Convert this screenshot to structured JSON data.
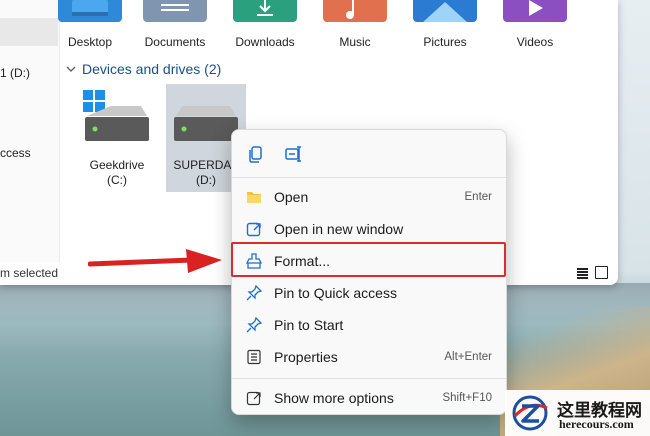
{
  "explorer": {
    "sidebar": {
      "items": [
        {
          "label": "1 (D:)"
        },
        {
          "label": "ccess"
        }
      ]
    },
    "status": {
      "text": "m selected"
    },
    "folders": [
      {
        "label": "Desktop",
        "icon": "desktop-folder-icon",
        "color": "#2e8ad8"
      },
      {
        "label": "Documents",
        "icon": "documents-folder-icon",
        "color": "#8096b0"
      },
      {
        "label": "Downloads",
        "icon": "downloads-folder-icon",
        "color": "#2aa07f"
      },
      {
        "label": "Music",
        "icon": "music-folder-icon",
        "color": "#e0704e"
      },
      {
        "label": "Pictures",
        "icon": "pictures-folder-icon",
        "color": "#2a7bd1"
      },
      {
        "label": "Videos",
        "icon": "videos-folder-icon",
        "color": "#8c4fc2"
      }
    ],
    "drives_group": {
      "label": "Devices and drives (2)"
    },
    "drives": [
      {
        "name": "Geekdrive",
        "letter": "(C:)",
        "icon": "windows-drive-icon"
      },
      {
        "name": "SUPERDAV",
        "letter": "(D:)",
        "icon": "drive-icon",
        "selected": true
      }
    ]
  },
  "context_menu": {
    "top_actions": [
      {
        "name": "copy",
        "icon": "copy-icon"
      },
      {
        "name": "rename",
        "icon": "rename-icon"
      }
    ],
    "items": [
      {
        "label": "Open",
        "shortcut": "Enter",
        "icon": "folder-open-icon"
      },
      {
        "label": "Open in new window",
        "shortcut": "",
        "icon": "open-new-window-icon"
      },
      {
        "label": "Format...",
        "shortcut": "",
        "icon": "format-icon",
        "highlighted": true
      },
      {
        "label": "Pin to Quick access",
        "shortcut": "",
        "icon": "pin-icon"
      },
      {
        "label": "Pin to Start",
        "shortcut": "",
        "icon": "pin-start-icon"
      },
      {
        "label": "Properties",
        "shortcut": "Alt+Enter",
        "icon": "properties-icon"
      },
      {
        "label": "Show more options",
        "shortcut": "Shift+F10",
        "icon": "more-options-icon"
      }
    ]
  },
  "annotation": {
    "highlight_color": "#e02a2a"
  },
  "watermark": {
    "cn": "这里教程网",
    "url": "herecours.com"
  }
}
